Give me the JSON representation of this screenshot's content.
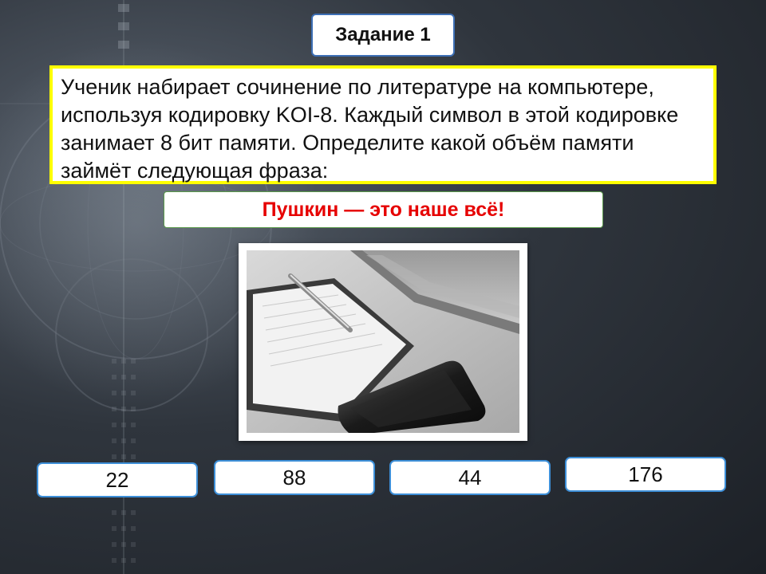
{
  "slide": {
    "title": "Задание 1",
    "task_text": "Ученик набирает сочинение по литературе на компьютере, используя кодировку KOI-8. Каждый символ в этой кодировке занимает 8 бит памяти. Определите какой объём памяти займёт следующая фраза:",
    "phrase": "Пушкин — это наше всё!",
    "answers": [
      "22",
      "88",
      "44",
      "176"
    ]
  },
  "colors": {
    "title_border": "#3d6fb5",
    "task_border": "#ffff00",
    "phrase_text": "#e60000",
    "answer_border": "#3d8fd8",
    "background": "#2f353d"
  },
  "icons": {
    "background": "globe-tech-background",
    "photo": "notebook-laptop-phone-photo"
  }
}
